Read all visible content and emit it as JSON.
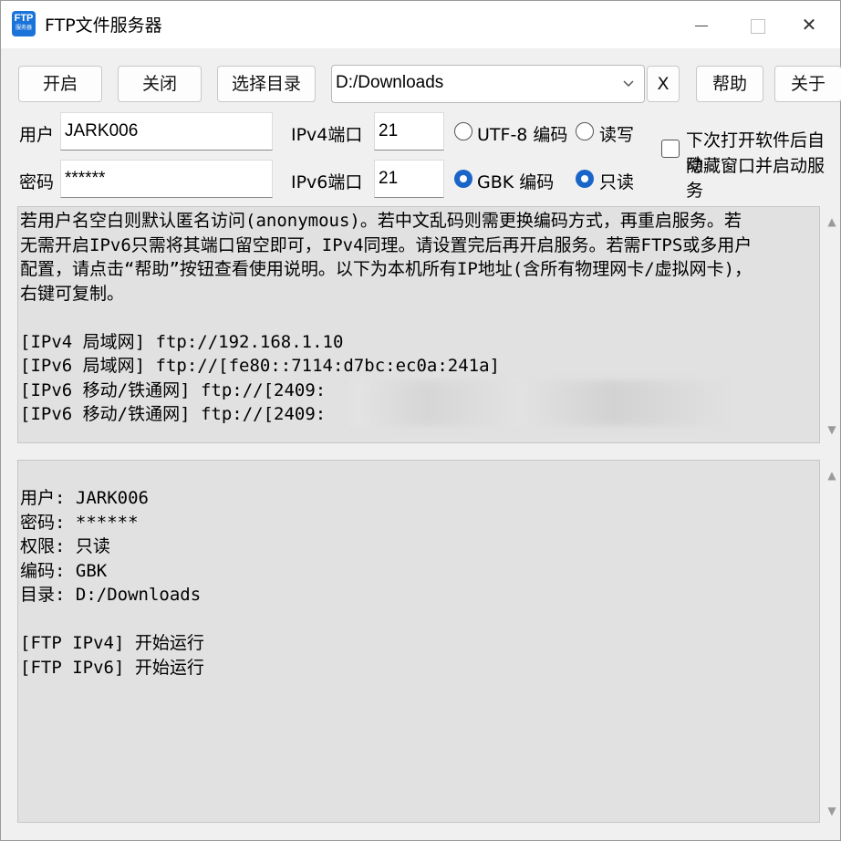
{
  "window": {
    "title": "FTP文件服务器",
    "icon_text_top": "FTP",
    "icon_text_bottom": "服务器"
  },
  "toolbar": {
    "start": "开启",
    "stop": "关闭",
    "choose_dir": "选择目录",
    "directory": "D:/Downloads",
    "clear": "X",
    "help": "帮助",
    "about": "关于"
  },
  "form": {
    "user_label": "用户",
    "user_value": "JARK006",
    "password_label": "密码",
    "password_value": "******",
    "ipv4_port_label": "IPv4端口",
    "ipv4_port_value": "21",
    "ipv6_port_label": "IPv6端口",
    "ipv6_port_value": "21",
    "utf8_label": "UTF-8 编码",
    "gbk_label": "GBK 编码",
    "rw_label": "读写",
    "ro_label": "只读",
    "autostart_line1": "下次打开软件后自动",
    "autostart_line2": "隐藏窗口并启动服务",
    "encoding_selected": "GBK",
    "permission_selected": "只读"
  },
  "info_text": "若用户名空白则默认匿名访问(anonymous)。若中文乱码则需更换编码方式，再重启服务。若\n无需开启IPv6只需将其端口留空即可，IPv4同理。请设置完后再开启服务。若需FTPS或多用户\n配置，请点击“帮助”按钮查看使用说明。以下为本机所有IP地址(含所有物理网卡/虚拟网卡)，\n右键可复制。\n\n[IPv4 局域网] ftp://192.168.1.10\n[IPv6 局域网] ftp://[fe80::7114:d7bc:ec0a:241a]\n[IPv6 移动/铁通网] ftp://[2409:\n[IPv6 移动/铁通网] ftp://[2409:",
  "log_text": "用户: JARK006\n密码: ******\n权限: 只读\n编码: GBK\n目录: D:/Downloads\n\n[FTP IPv4] 开始运行\n[FTP IPv6] 开始运行",
  "colors": {
    "accent": "#1a66c8",
    "panel": "#e1e1e1"
  }
}
